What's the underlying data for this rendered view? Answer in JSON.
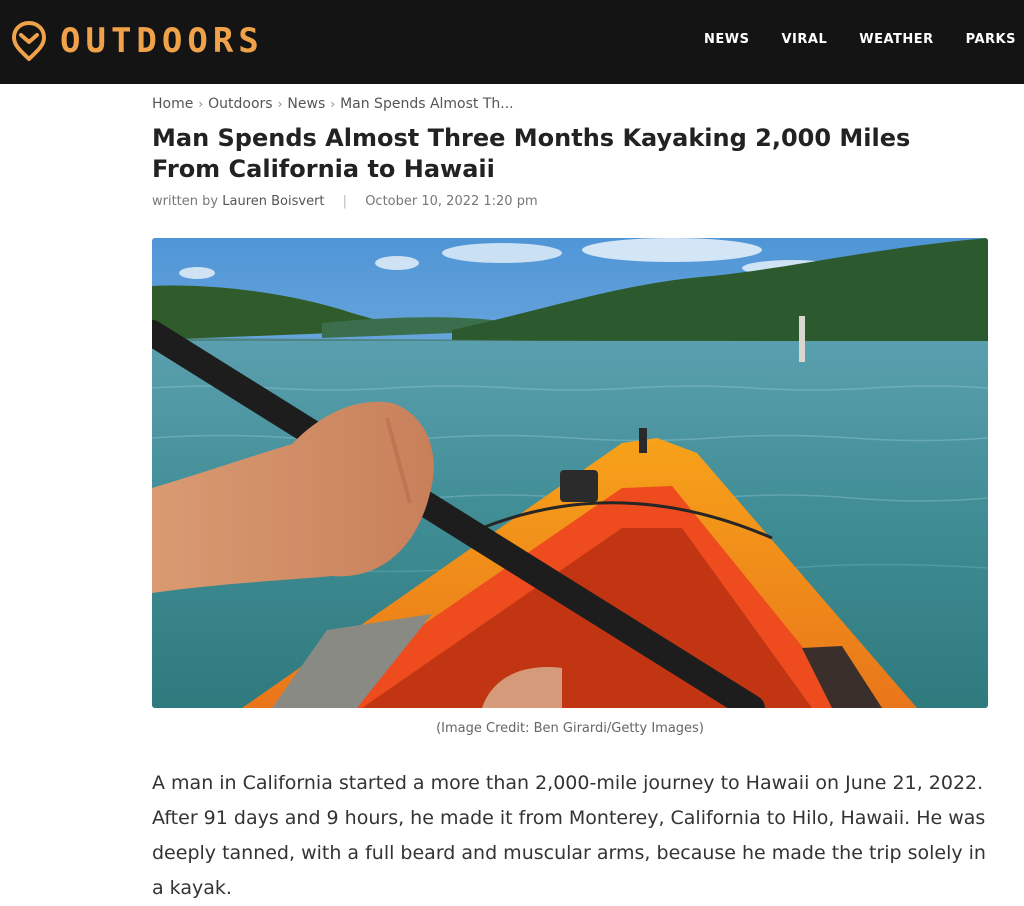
{
  "header": {
    "logo_text": "OUTDOORS",
    "nav": [
      "NEWS",
      "VIRAL",
      "WEATHER",
      "PARKS"
    ],
    "accent_color": "#f0a24a",
    "background_color": "#141414"
  },
  "breadcrumb": [
    "Home",
    "Outdoors",
    "News",
    "Man Spends Almost Th..."
  ],
  "article": {
    "title": "Man Spends Almost Three Months Kayaking 2,000 Miles From California to Hawaii",
    "byline_prefix": "written by",
    "author": "Lauren Boisvert",
    "date": "October 10, 2022 1:20 pm",
    "image_caption": "(Image Credit: Ben Girardi/Getty Images)",
    "first_paragraph": "A man in California started a more than 2,000-mile journey to Hawaii on June 21, 2022. After 91 days and 9 hours, he made it from Monterey, California to Hilo, Hawaii. He was deeply tanned, with a full beard and muscular arms, because he made the trip solely in a kayak."
  }
}
